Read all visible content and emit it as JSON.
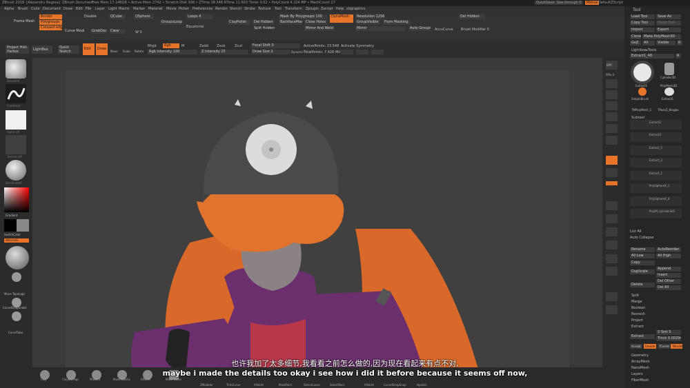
{
  "title_bar": {
    "app": "ZBrush 2018",
    "user": "[Alexandru Negrea]",
    "doc": "ZBrush Document",
    "stats": "Free Mem 17.146GB • Active Mem 2742 • Scratch Disk 938 • ZTime 38.548 RTime 11.603 Timer 0.02 • PolyCount 4.224 MP • MeshCount 27",
    "quicksave": "QuickSave",
    "see_through": "See-through 0",
    "menus_btn": "Menus",
    "script": "DefaultZScript"
  },
  "menu_bar": [
    "Alpha",
    "Brush",
    "Color",
    "Document",
    "Draw",
    "Edit",
    "File",
    "Layer",
    "Light",
    "Macro",
    "Marker",
    "Material",
    "Movie",
    "Picker",
    "Preferences",
    "Render",
    "Stencil",
    "Stroke",
    "Texture",
    "Tool",
    "Transform",
    "Zplugin",
    "Zscript",
    "Help",
    "zbgraphics"
  ],
  "top_controls": {
    "frame_mesh": "Frame Mesh",
    "border": "Border",
    "polygroups": "Polygroups",
    "creased_edges": "Creased edges",
    "curve_mode": "Curve Mode",
    "double": "Double",
    "grab_doc": "GrabDoc",
    "qcube": "QCube",
    "clear": "Clear",
    "qsphere": "QSphere",
    "wf": "W 0",
    "groups_loops": "GroupsLoops",
    "loops": "Loops 4",
    "equatorial": "Equatorial",
    "claypolish": "ClayPolish",
    "del_hidden": "Del Hidden",
    "split_hidden": "Split Hidden",
    "mask_by_polygroups": "Mask By Polygroups 100",
    "backface_mask": "BackfaceMask",
    "close_holes": "Close Holes",
    "mirror_and_weld": "Mirror And Weld",
    "dynamesh": "DynaMesh",
    "resolution": "Resolution 1256",
    "group_visible": "GroupVisible",
    "from_masking": "From Masking",
    "mirror": "Mirror",
    "auto_groups": "Auto Groups",
    "accucurve": "AccuCurve",
    "del_hidden2": "Del Hidden",
    "brush_modifier": "Brush Modifier 0"
  },
  "tool_shelf": {
    "project_history": "Project Hist.\nHarbor",
    "lightbox": "LightBox",
    "quick_sketch": "Quick\nSketch",
    "edit": "Edit",
    "draw": "Draw",
    "move": "Move",
    "scale": "Scale",
    "rotate": "Rotate",
    "mrgb": "Mrgb",
    "rgb": "Rgb",
    "m": "M",
    "zadd": "Zadd",
    "zsub": "Zsub",
    "zcut": "Zcut",
    "rgb_intensity": "Rgb Intensity 100",
    "z_intensity": "Z Intensity 25",
    "focal_shift": "Focal Shift 0",
    "draw_size": "Draw Size 2",
    "dynamic": "Dynamic",
    "active_points": "ActivePoints: 23.548",
    "total_points": "TotalPoints: 7.426 Mil",
    "activate_symmetry": "Activate Symmetry"
  },
  "left_shelf": {
    "brush_label": "Standard",
    "stroke_label": "FreeHand",
    "alpha_label": "Alpha Off",
    "texture_label": "Texture Off",
    "material_label": "SkinShade4",
    "gradient": "Gradient",
    "switch_color": "SwitchColor",
    "alternate": "Alternate",
    "bottom_brushes": [
      "Move Topologic",
      "CurveStrapSnake",
      "CurveTube"
    ]
  },
  "right_shelf": [
    "BPR",
    "SPix 3",
    "Scroll",
    "Zoom",
    "Actual",
    "AAHalf",
    "Persp",
    "Floor",
    "Local",
    "Frame",
    "Move",
    "Scale",
    "Rotate",
    "LineFill",
    "PolyF",
    "Transp",
    "Dynamic",
    "Solo",
    "Xpose"
  ],
  "tool_tray": {
    "tool_title": "Tool",
    "load_tool": "Load Tool",
    "save_as": "Save As",
    "copy_tool": "Copy Tool",
    "paste_tool": "Paste Tool",
    "import": "Import",
    "export": "Export",
    "clone": "Clone",
    "make_polymesh3d": "Make PolyMesh3D",
    "goz": "GoZ",
    "all": "All",
    "visible": "Visible",
    "r": "R",
    "lightbox_tools": "Lightbox▸Tools",
    "extract1": "Extract1_48",
    "r2": "R",
    "thumb_labels": [
      "Extract1",
      "Cylinder3D",
      "PolyMesh3D",
      "SimpleBrush",
      "Extract1",
      "TMPolyMesh_1",
      "TPoseZ_Ningbo"
    ],
    "subtool_title": "Subtool",
    "subtools": [
      "Extract2",
      "Extract3",
      "Extract_5",
      "Extract_3",
      "Extract_1",
      "PolySphere4_1",
      "PolySphere4_6",
      "PolyM_cylinder3d1"
    ],
    "list_all": "List All",
    "auto_collapse": "Auto Collapse",
    "rename": "Rename",
    "autoreorder": "AutoReorder",
    "all_low": "All Low",
    "all_high": "All High",
    "copy": "Copy",
    "append": "Append",
    "duplicate": "Duplicate",
    "insert": "Insert",
    "delete": "Delete",
    "del_other": "Del Other",
    "del_all": "Del All",
    "split": "Split",
    "merge": "Merge",
    "boolean": "Boolean",
    "remesh": "Remesh",
    "project": "Project",
    "extract": "Extract",
    "extract_btn": "Extract",
    "s_smt": "S Smt 5",
    "thick": "Thick 0.00294",
    "accept": "Accept",
    "double": "Double",
    "tcorner": "TCorner",
    "tborder": "TBorder",
    "geometry": "Geometry",
    "arraymesh": "ArrayMesh",
    "nanomesh": "NanoMesh",
    "layers": "Layers",
    "fibermesh": "FiberMesh"
  },
  "bottom_brushes": [
    "Clay",
    "ClayBuildup",
    "Mask41",
    "Move Elastic",
    "hPolish",
    "Mask Lasso",
    "ZModeler",
    "TrimCurve",
    "hPolish",
    "MaskRect",
    "SelectLasso",
    "SelectRect",
    "hPolish",
    "CurveStrapSnap",
    "Hpolish"
  ],
  "subtitles": {
    "chinese": "也许我加了太多细节,我看看之前怎么做的,因为现在看起来有点不对,",
    "english": "maybe i made the details too okay i see how i did it before because it seems off now,"
  },
  "colors": {
    "accent": "#e8742a",
    "hair": "#d9692a",
    "hoodie": "#6b2f6e",
    "shirt": "#b8384a",
    "cap": "#4a4a4c",
    "skin": "#8a8283"
  }
}
